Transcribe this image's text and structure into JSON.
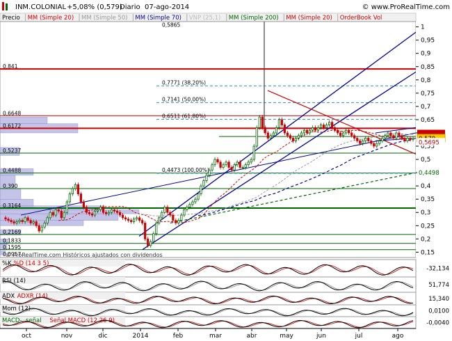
{
  "header": {
    "symbol": "INM.COLONIAL",
    "change": "+5,08% (0,579)",
    "period": "Diario",
    "date": "07-ago-2014",
    "site": "© www.ProRealTime.com",
    "watermark": "© ProRealTime.com   Históricos ajustados con dividendos"
  },
  "legend": [
    {
      "text": "Precio",
      "color": "#000000"
    },
    {
      "text": "MM (Simple 20)",
      "color": "#cc0000"
    },
    {
      "text": "MM (Simple 50)",
      "color": "#999999"
    },
    {
      "text": "MM (Simple 70)",
      "color": "#000099"
    },
    {
      "text": "VNP (25,1)",
      "color": "#bbbbbb"
    },
    {
      "text": "MM (Simple 200)",
      "color": "#006600"
    },
    {
      "text": "MM (Simple 20)",
      "color": "#cc0000"
    },
    {
      "text": "OrderBook Vol",
      "color": "#cc0000"
    }
  ],
  "colors": {
    "candle_up": "#006600",
    "candle_down": "#cc0000",
    "channel": "#000099",
    "resistance": "#cc0000",
    "support": "#006600",
    "fib": "#3399cc",
    "volume_profile": "#b0b0e0"
  },
  "chart_data": {
    "type": "candlestick",
    "x_ticks": [
      "oct",
      "nov",
      "dic",
      "2014",
      "feb",
      "mar",
      "abr",
      "may",
      "jun",
      "jul",
      "ago"
    ],
    "y_ticks": [
      "1",
      "0,95",
      "0,9",
      "0,85",
      "0,8",
      "0,75",
      "0,7",
      "0,65",
      "0,6",
      "0,55",
      "0,5",
      "0,45",
      "0,4",
      "0,35",
      "0,3",
      "0,25",
      "0,2",
      "0,15"
    ],
    "ylim": [
      0.13,
      1.02
    ],
    "left_levels": [
      "0,841",
      "0,6648",
      "0,6172",
      "0,5237",
      "0,4488",
      "0,390",
      "0,3164",
      "0,2169",
      "0,1833",
      "0,1595",
      "0,0957"
    ],
    "right_labels": [
      "0,5919",
      "0,579",
      "0,5695",
      "0,4498"
    ],
    "fib_labels": [
      "0,5865",
      "0,7771 (38,20%)",
      "0,7141 (50,00%)",
      "0,6511 (61,80%)",
      "0,4473 (100,00%)"
    ],
    "close_series": [
      0.28,
      0.275,
      0.27,
      0.265,
      0.26,
      0.265,
      0.27,
      0.265,
      0.28,
      0.27,
      0.26,
      0.265,
      0.25,
      0.23,
      0.245,
      0.26,
      0.28,
      0.3,
      0.29,
      0.31,
      0.305,
      0.28,
      0.3,
      0.34,
      0.37,
      0.39,
      0.405,
      0.37,
      0.34,
      0.32,
      0.3,
      0.295,
      0.29,
      0.305,
      0.31,
      0.32,
      0.3,
      0.295,
      0.3,
      0.31,
      0.305,
      0.3,
      0.29,
      0.28,
      0.275,
      0.27,
      0.265,
      0.275,
      0.28,
      0.27,
      0.26,
      0.2,
      0.175,
      0.19,
      0.22,
      0.26,
      0.28,
      0.3,
      0.32,
      0.3,
      0.29,
      0.27,
      0.26,
      0.27,
      0.29,
      0.31,
      0.32,
      0.33,
      0.34,
      0.35,
      0.37,
      0.4,
      0.42,
      0.44,
      0.46,
      0.48,
      0.5,
      0.49,
      0.47,
      0.48,
      0.49,
      0.47,
      0.46,
      0.48,
      0.49,
      0.47,
      0.47,
      0.48,
      0.49,
      0.5,
      0.55,
      0.62,
      0.66,
      0.62,
      0.6,
      0.58,
      0.59,
      0.6,
      0.62,
      0.65,
      0.63,
      0.6,
      0.59,
      0.58,
      0.57,
      0.58,
      0.59,
      0.6,
      0.61,
      0.6,
      0.61,
      0.62,
      0.61,
      0.62,
      0.63,
      0.62,
      0.63,
      0.64,
      0.62,
      0.61,
      0.6,
      0.59,
      0.6,
      0.61,
      0.6,
      0.59,
      0.58,
      0.57,
      0.56,
      0.57,
      0.58,
      0.57,
      0.56,
      0.55,
      0.56,
      0.57,
      0.58,
      0.59,
      0.6,
      0.59,
      0.58,
      0.6,
      0.59,
      0.58,
      0.57,
      0.58,
      0.575,
      0.579
    ],
    "rsi_value": "51,774",
    "stoch_value": "-32,134",
    "adx_value": "15,340",
    "mom_value": "0,0100",
    "macd_value": "-0,0040"
  },
  "indicators": [
    {
      "label": "%K",
      "label2": "%D (14 3 5)",
      "value": "-32,134",
      "color": "#000000",
      "color2": "#cc0000"
    },
    {
      "label": "RSI (14)",
      "label2": "",
      "value": "51,774",
      "color": "#000000",
      "color2": "#000000"
    },
    {
      "label": "ADX",
      "label2": "ADXR (14)",
      "value": "15,340",
      "color": "#000000",
      "color2": "#cc0000"
    },
    {
      "label": "Mom (12)",
      "label2": "",
      "value": "0,0100",
      "color": "#000000",
      "color2": "#000000"
    },
    {
      "label": "MACD-, señal",
      "label2": "Señal  MACD (12 26 9)",
      "value": "-0,0040",
      "color": "#006600",
      "color2": "#cc0000"
    }
  ]
}
